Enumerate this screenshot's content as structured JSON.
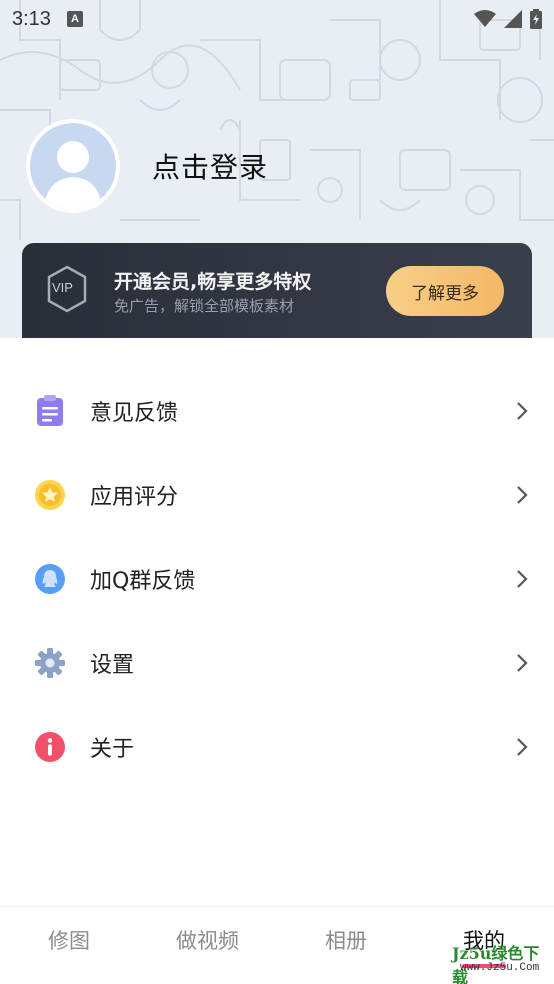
{
  "status_bar": {
    "time": "3:13",
    "notification_letter": "A"
  },
  "profile": {
    "login_text": "点击登录"
  },
  "vip": {
    "badge_text": "VIP",
    "title": "开通会员,畅享更多特权",
    "subtitle": "免广告，解锁全部模板素材",
    "button_label": "了解更多"
  },
  "menu": {
    "items": [
      {
        "label": "意见反馈",
        "icon": "clipboard-icon",
        "color": "#8f7cf0"
      },
      {
        "label": "应用评分",
        "icon": "star-icon",
        "color": "#f5c83c"
      },
      {
        "label": "加Q群反馈",
        "icon": "qq-icon",
        "color": "#5a9df7"
      },
      {
        "label": "设置",
        "icon": "gear-icon",
        "color": "#8ca2c6"
      },
      {
        "label": "关于",
        "icon": "info-icon",
        "color": "#f2506a"
      }
    ]
  },
  "tabbar": {
    "tabs": [
      {
        "label": "修图"
      },
      {
        "label": "做视频"
      },
      {
        "label": "相册"
      },
      {
        "label": "我的"
      }
    ],
    "active_color": "#f04a75"
  },
  "watermark": {
    "text": "Jz5u绿色下载",
    "sub": "www.Jz5u.Com"
  }
}
